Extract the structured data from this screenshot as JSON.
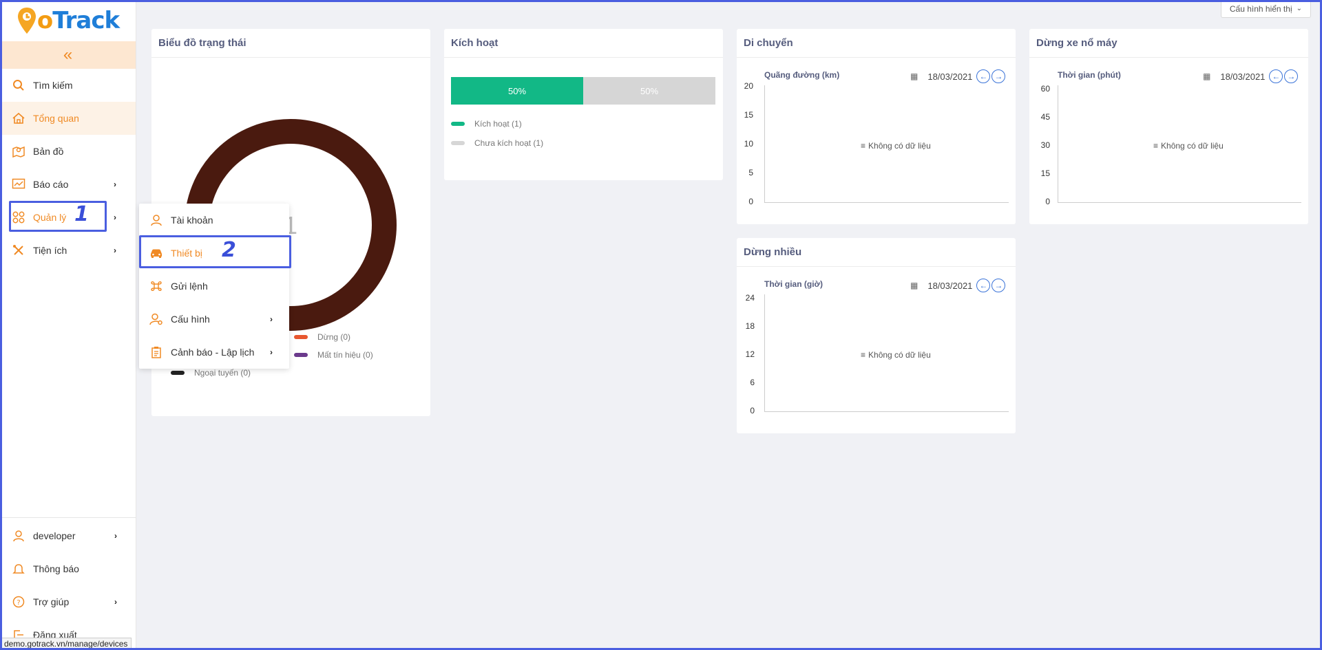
{
  "logo": {
    "g": "G",
    "o": "o",
    "track": "Track"
  },
  "sidebar": {
    "collapse_icon": "«",
    "items": [
      {
        "label": "Tìm kiếm",
        "icon": "search-icon"
      },
      {
        "label": "Tổng quan",
        "icon": "home-icon"
      },
      {
        "label": "Bản đồ",
        "icon": "map-icon"
      },
      {
        "label": "Báo cáo",
        "icon": "chart-icon"
      },
      {
        "label": "Quản lý",
        "icon": "grid-icon"
      },
      {
        "label": "Tiện ích",
        "icon": "tools-icon"
      }
    ],
    "bottom": [
      {
        "label": "developer",
        "icon": "user-icon"
      },
      {
        "label": "Thông báo",
        "icon": "bell-icon"
      },
      {
        "label": "Trợ giúp",
        "icon": "help-icon"
      },
      {
        "label": "Đăng xuất",
        "icon": "logout-icon"
      }
    ]
  },
  "annotations": {
    "step1": "1",
    "step2": "2"
  },
  "submenu": {
    "items": [
      {
        "label": "Tài khoản",
        "icon": "user-icon"
      },
      {
        "label": "Thiết bị",
        "icon": "car-icon"
      },
      {
        "label": "Gửi lệnh",
        "icon": "command-icon"
      },
      {
        "label": "Cấu hình",
        "icon": "user-gear-icon"
      },
      {
        "label": "Cảnh báo - Lập lịch",
        "icon": "clipboard-icon"
      }
    ]
  },
  "status_url": "demo.gotrack.vn/manage/devices",
  "config_button": "Cấu hình hiển thị",
  "status_chart": {
    "title": "Biểu đồ trạng thái",
    "center_value": "1",
    "ring_color": "#4a1a0f",
    "legend": [
      {
        "label": "Dừng (0)",
        "color": "#e8572f"
      },
      {
        "label": "Mất tín hiệu (0)",
        "color": "#6b3a8c"
      },
      {
        "label": "Ngoại tuyến (0)",
        "color": "#222222"
      }
    ]
  },
  "activation": {
    "title": "Kích hoạt",
    "active_pct": "50%",
    "inactive_pct": "50%",
    "active_color": "#12b886",
    "inactive_color": "#d6d6d6",
    "legend": [
      {
        "label": "Kích hoạt (1)",
        "color": "#12b886"
      },
      {
        "label": "Chưa kích hoạt (1)",
        "color": "#d6d6d6"
      }
    ]
  },
  "movement": {
    "title": "Di chuyển",
    "subtitle": "Quãng đường (km)",
    "date": "18/03/2021",
    "yticks": [
      "20",
      "15",
      "10",
      "5",
      "0"
    ],
    "nodata": "Không có dữ liệu"
  },
  "engine_idle": {
    "title": "Dừng xe nổ máy",
    "subtitle": "Thời gian (phút)",
    "date": "18/03/2021",
    "yticks": [
      "60",
      "45",
      "30",
      "15",
      "0"
    ],
    "nodata": "Không có dữ liệu"
  },
  "stops": {
    "title": "Dừng nhiều",
    "subtitle": "Thời gian (giờ)",
    "date": "18/03/2021",
    "yticks": [
      "24",
      "18",
      "12",
      "6",
      "0"
    ],
    "nodata": "Không có dữ liệu"
  }
}
